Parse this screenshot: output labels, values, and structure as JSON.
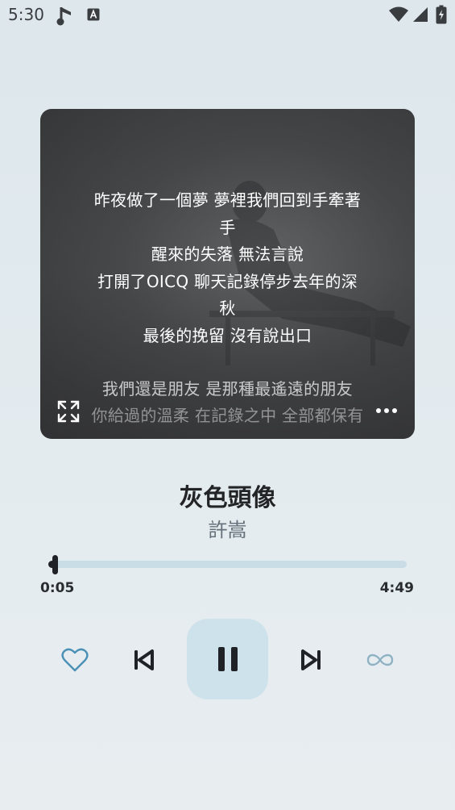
{
  "status_bar": {
    "time": "5:30",
    "icons": [
      "music-note-icon",
      "keyboard-a-icon",
      "wifi-icon",
      "cell-signal-icon",
      "battery-charging-icon"
    ]
  },
  "lyrics": {
    "lines": [
      "昨夜做了一個夢 夢裡我們回到手牽著",
      "手",
      "醒來的失落 無法言說",
      "打開了OICQ 聊天記錄停步去年的深",
      "秋",
      "最後的挽留 沒有說出口",
      "",
      "我們還是朋友 是那種最遙遠的朋友",
      "你給過的溫柔 在記錄之中 全部都保有"
    ]
  },
  "song": {
    "title": "灰色頭像",
    "artist": "許嵩"
  },
  "progress": {
    "elapsed": "0:05",
    "total": "4:49",
    "fraction": 0.017
  },
  "controls": {
    "favorite": "heart-outline-icon",
    "previous": "skip-previous-icon",
    "play_pause": "pause-icon",
    "next": "skip-next-icon",
    "repeat_mode": "infinity-loop-icon"
  },
  "colors": {
    "accent": "#4a90b5",
    "play_button_bg": "#cde2ea",
    "track": "#c9dde6",
    "card_bg": "#4c4e50"
  }
}
